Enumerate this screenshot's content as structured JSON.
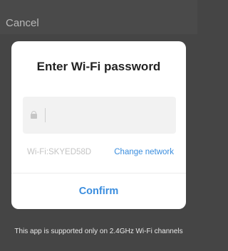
{
  "header": {
    "cancel_label": "Cancel"
  },
  "dialog": {
    "title": "Enter Wi-Fi password",
    "password_field": {
      "value": "",
      "placeholder": "",
      "icon": "lock-icon"
    },
    "wifi_label": "Wi-Fi:SKYED58D",
    "change_network_label": "Change network",
    "confirm_label": "Confirm"
  },
  "footer": {
    "notice": "This app is supported only on 2.4GHz Wi-Fi channels"
  },
  "colors": {
    "accent": "#3a8dde",
    "overlay": "#454545",
    "dialog_bg": "#ffffff"
  }
}
